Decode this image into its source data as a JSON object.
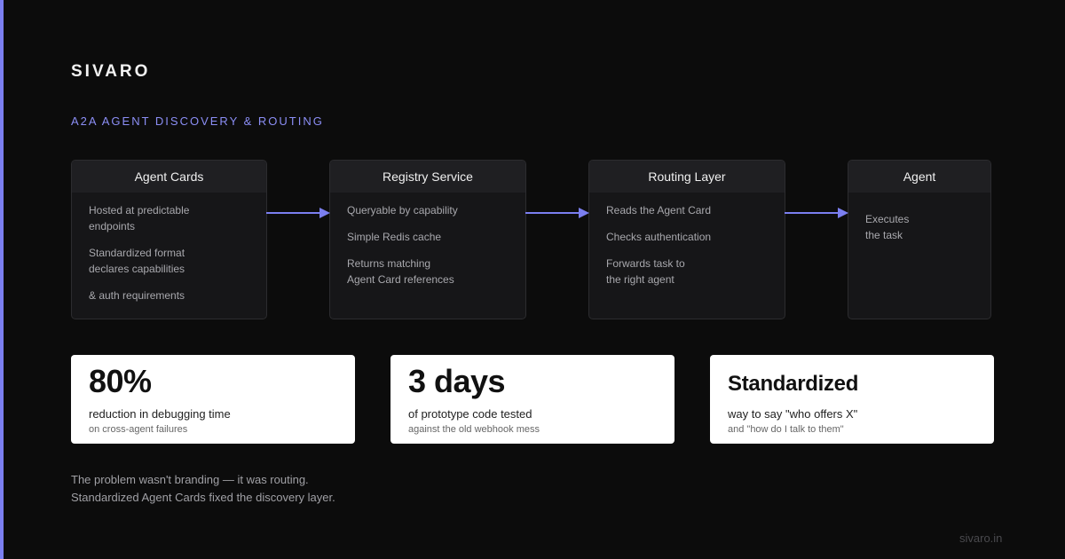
{
  "brand": "SIVARO",
  "subtitle": "A2A AGENT DISCOVERY & ROUTING",
  "accent_color": "#7b7ff0",
  "flow": {
    "nodes": [
      {
        "title": "Agent Cards",
        "lines": [
          "Hosted at predictable\nendpoints",
          "Standardized format\ndeclares capabilities",
          "& auth requirements"
        ]
      },
      {
        "title": "Registry Service",
        "lines": [
          "Queryable by capability",
          "Simple Redis cache",
          "Returns matching\nAgent Card references"
        ]
      },
      {
        "title": "Routing Layer",
        "lines": [
          "Reads the Agent Card",
          "Checks authentication",
          "Forwards task to\nthe right agent"
        ]
      },
      {
        "title": "Agent",
        "lines": [
          "Executes\nthe task"
        ]
      }
    ],
    "edges": [
      {
        "from": 0,
        "to": 1
      },
      {
        "from": 1,
        "to": 2
      },
      {
        "from": 2,
        "to": 3
      }
    ]
  },
  "stats": [
    {
      "value": "80%",
      "label": "reduction in debugging time",
      "sub": "on cross-agent failures"
    },
    {
      "value": "3 days",
      "label": "of prototype code tested",
      "sub": "against the old webhook mess"
    },
    {
      "value": "Standardized",
      "label": "way to say \"who offers X\"",
      "sub": "and \"how do I talk to them\""
    }
  ],
  "footnote": {
    "line1": "The problem wasn't branding — it was routing.",
    "line2": "Standardized Agent Cards fixed the discovery layer."
  },
  "footer_url": "sivaro.in"
}
